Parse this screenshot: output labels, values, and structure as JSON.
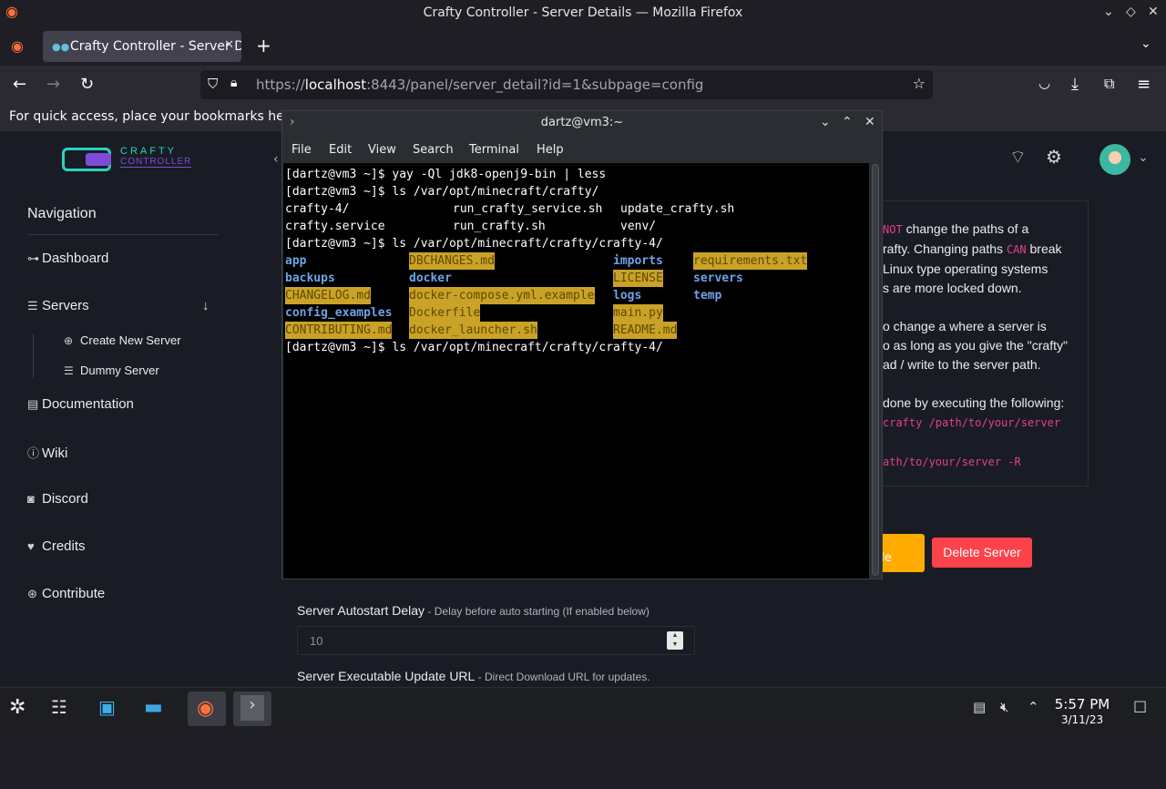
{
  "window": {
    "title": "Crafty Controller - Server Details — Mozilla Firefox"
  },
  "browser": {
    "tab_title": "Crafty Controller - Server Details",
    "url_prefix": "https://",
    "url_host": "localhost",
    "url_rest": ":8443/panel/server_detail?id=1&subpage=config",
    "bookmarks_hint": "For quick access, place your bookmarks here on"
  },
  "crafty": {
    "logo_top": "CRAFTY",
    "logo_bottom": "CONTROLLER",
    "nav_heading": "Navigation",
    "nav": {
      "dashboard": "Dashboard",
      "servers": "Servers",
      "create_new_server": "Create New Server",
      "dummy_server": "Dummy Server",
      "documentation": "Documentation",
      "wiki": "Wiki",
      "discord": "Discord",
      "credits": "Credits",
      "contribute": "Contribute"
    },
    "info": {
      "p1_a": "NOT",
      "p1_b": " change the paths of a",
      "p1_c": "rafty. Changing paths ",
      "p1_d": "CAN",
      "p1_e": " break",
      "p1_f": "Linux type operating systems",
      "p1_g": "s are more locked down.",
      "p2_a": "o change a where a server is",
      "p2_b": "o as long as you give the \"crafty\"",
      "p2_c": "ad / write to the server path.",
      "p3_a": "done by executing the following:",
      "p3_b": "crafty /path/to/your/server",
      "p3_c": "ath/to/your/server -R"
    },
    "btn_warn_1": "te",
    "btn_warn_2": "able",
    "btn_delete": "Delete Server",
    "field_autostart_label": "Server Autostart Delay",
    "field_autostart_hint": " - Delay before auto starting (If enabled below)",
    "field_autostart_value": "10",
    "field_update_label": "Server Executable Update URL",
    "field_update_hint": " - Direct Download URL for updates."
  },
  "terminal": {
    "title": "dartz@vm3:~",
    "menu": [
      "File",
      "Edit",
      "View",
      "Search",
      "Terminal",
      "Help"
    ],
    "line1": "[dartz@vm3 ~]$ yay -Ql jdk8-openj9-bin | less",
    "line2": "[dartz@vm3 ~]$ ls /var/opt/minecraft/crafty/",
    "line3_a": "crafty-4/",
    "line3_b": "run_crafty_service.sh",
    "line3_c": "update_crafty.sh",
    "line4_a": "crafty.service",
    "line4_b": "run_crafty.sh",
    "line4_c": "venv/",
    "line5": "[dartz@vm3 ~]$ ls /var/opt/minecraft/crafty/crafty-4/",
    "files": {
      "app": "app",
      "dbchanges": "DBCHANGES.md",
      "imports": "imports",
      "requirements": "requirements.txt",
      "backups": "backups",
      "docker": "docker",
      "license": "LICENSE",
      "servers": "servers",
      "changelog": "CHANGELOG.md",
      "compose": "docker-compose.yml.example",
      "logs": "logs",
      "temp": "temp",
      "config_examples": "config_examples",
      "dockerfile": "Dockerfile",
      "mainpy": "main.py",
      "contributing": "CONTRIBUTING.md",
      "docker_launcher": "docker_launcher.sh",
      "readme": "README.md"
    },
    "line_last": "[dartz@vm3 ~]$ ls /var/opt/minecraft/crafty/crafty-4/"
  },
  "taskbar": {
    "time": "5:57 PM",
    "date": "3/11/23"
  }
}
